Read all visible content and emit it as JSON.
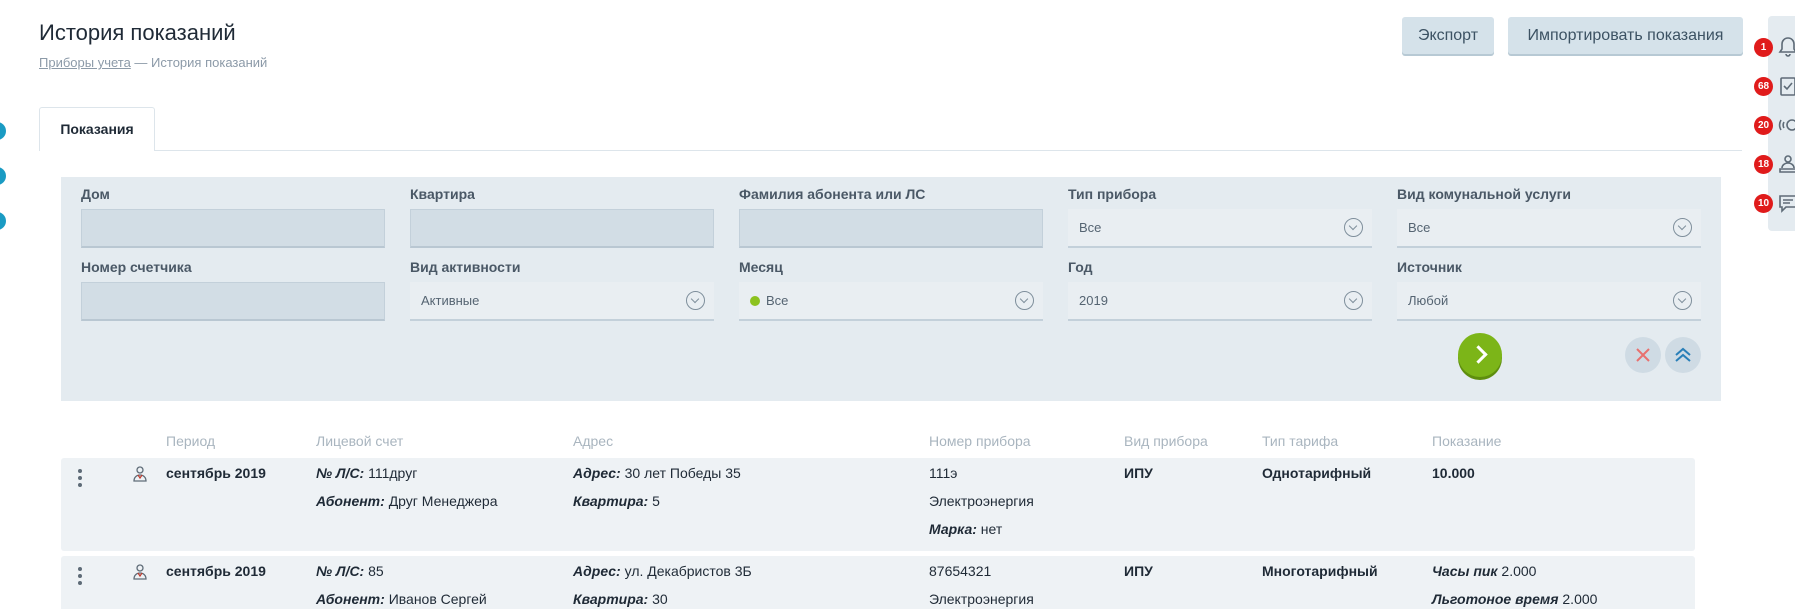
{
  "page": {
    "title": "История показаний",
    "breadcrumb": {
      "link": "Приборы учета",
      "separator": " — ",
      "current": "История показаний"
    }
  },
  "toolbar": {
    "export_label": "Экспорт",
    "import_label": "Импортировать показания"
  },
  "rail": [
    {
      "icon": "bell-icon",
      "count": "1"
    },
    {
      "icon": "clipboard-check-icon",
      "count": "68"
    },
    {
      "icon": "broadcast-icon",
      "count": "20"
    },
    {
      "icon": "user-desk-icon",
      "count": "18"
    },
    {
      "icon": "chat-icon",
      "count": "10"
    }
  ],
  "tabs": [
    {
      "label": "Показания",
      "active": true
    }
  ],
  "filters": {
    "house": {
      "label": "Дом",
      "value": ""
    },
    "apartment": {
      "label": "Квартира",
      "value": ""
    },
    "subscriber": {
      "label": "Фамилия абонента или ЛС",
      "value": ""
    },
    "device_type": {
      "label": "Тип прибора",
      "value": "Все"
    },
    "service_type": {
      "label": "Вид комунальной услуги",
      "value": "Все"
    },
    "meter_number": {
      "label": "Номер счетчика",
      "value": ""
    },
    "activity": {
      "label": "Вид активности",
      "value": "Активные"
    },
    "month": {
      "label": "Месяц",
      "value": "Все"
    },
    "year": {
      "label": "Год",
      "value": "2019"
    },
    "source": {
      "label": "Источник",
      "value": "Любой"
    }
  },
  "table": {
    "columns": [
      "Период",
      "Лицевой счет",
      "Адрес",
      "Номер прибора",
      "Вид прибора",
      "Тип тарифа",
      "Показание"
    ],
    "rows": [
      {
        "period": "сентябрь 2019",
        "account_label": "№ Л/С:",
        "account": "111друг",
        "subscriber_label": "Абонент:",
        "subscriber": "Друг Менеджера",
        "address_label": "Адрес:",
        "address": "30 лет Победы 35",
        "apt_label": "Квартира:",
        "apt": "5",
        "device_number": "111э",
        "resource": "Электроэнергия",
        "brand_label": "Марка:",
        "brand": "нет",
        "device_kind": "ИПУ",
        "tariff": "Однотарифный",
        "reading": "10.000"
      },
      {
        "period": "сентябрь 2019",
        "account_label": "№ Л/С:",
        "account": "85",
        "subscriber_label": "Абонент:",
        "subscriber": "Иванов Сергей",
        "address_label": "Адрес:",
        "address": "ул. Декабристов 3Б",
        "apt_label": "Квартира:",
        "apt": "30",
        "device_number": "87654321",
        "resource": "Электроэнергия",
        "device_kind": "ИПУ",
        "tariff": "Многотарифный",
        "reading1_label": "Часы пик",
        "reading1": "2.000",
        "reading2_label": "Льготоное время",
        "reading2": "2.000"
      }
    ]
  },
  "colors": {
    "accent_green": "#7cb518",
    "badge_red": "#e01b1b",
    "panel_bg": "#e4ebf0"
  }
}
